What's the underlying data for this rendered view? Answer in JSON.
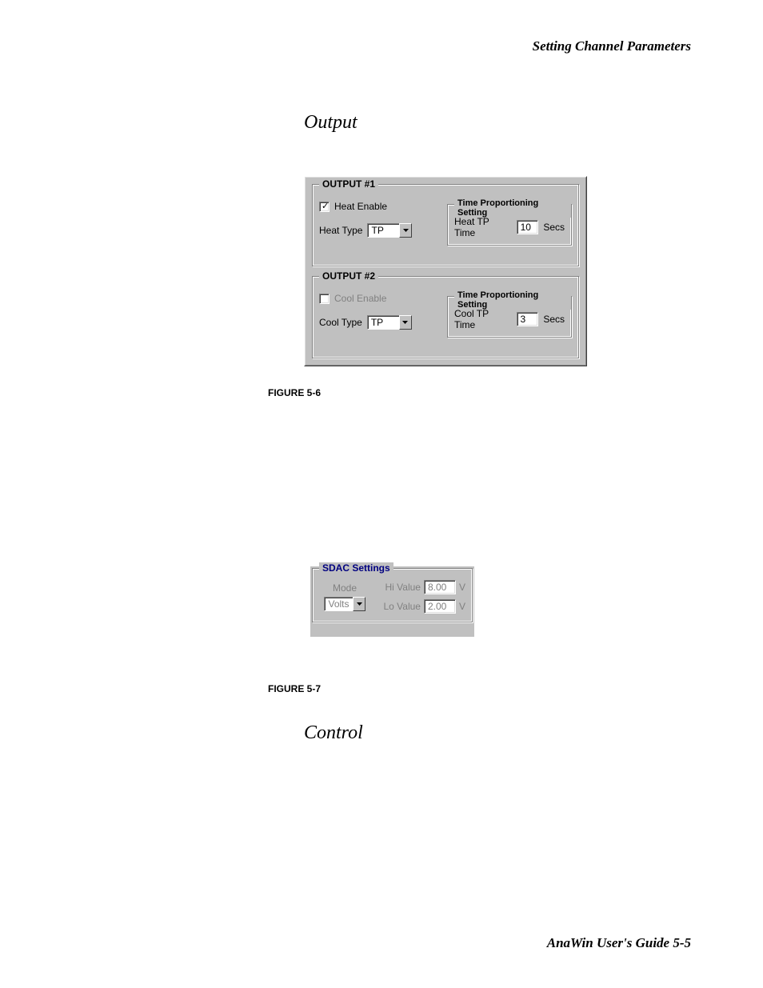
{
  "header": {
    "text": "Setting Channel Parameters"
  },
  "sections": {
    "output": "Output",
    "control": "Control"
  },
  "figure_labels": {
    "fig56": "FIGURE 5-6",
    "fig57": "FIGURE 5-7"
  },
  "footer": {
    "text": "AnaWin User's Guide  5-5"
  },
  "fig56": {
    "output1": {
      "title": "OUTPUT #1",
      "heat_enable": {
        "label": "Heat Enable",
        "checked": true
      },
      "heat_type": {
        "label": "Heat Type",
        "value": "TP"
      },
      "tp_setting_title": "Time Proportioning Setting",
      "heat_tp": {
        "label": "Heat TP Time",
        "value": "10",
        "unit": "Secs"
      }
    },
    "output2": {
      "title": "OUTPUT #2",
      "cool_enable": {
        "label": "Cool Enable",
        "checked": false
      },
      "cool_type": {
        "label": "Cool Type",
        "value": "TP"
      },
      "tp_setting_title": "Time Proportioning Setting",
      "cool_tp": {
        "label": "Cool TP Time",
        "value": "3",
        "unit": "Secs"
      }
    }
  },
  "fig57": {
    "title": "SDAC Settings",
    "mode": {
      "label": "Mode",
      "value": "Volts"
    },
    "hi": {
      "label": "Hi Value",
      "value": "8.00",
      "unit": "V"
    },
    "lo": {
      "label": "Lo Value",
      "value": "2.00",
      "unit": "V"
    }
  }
}
